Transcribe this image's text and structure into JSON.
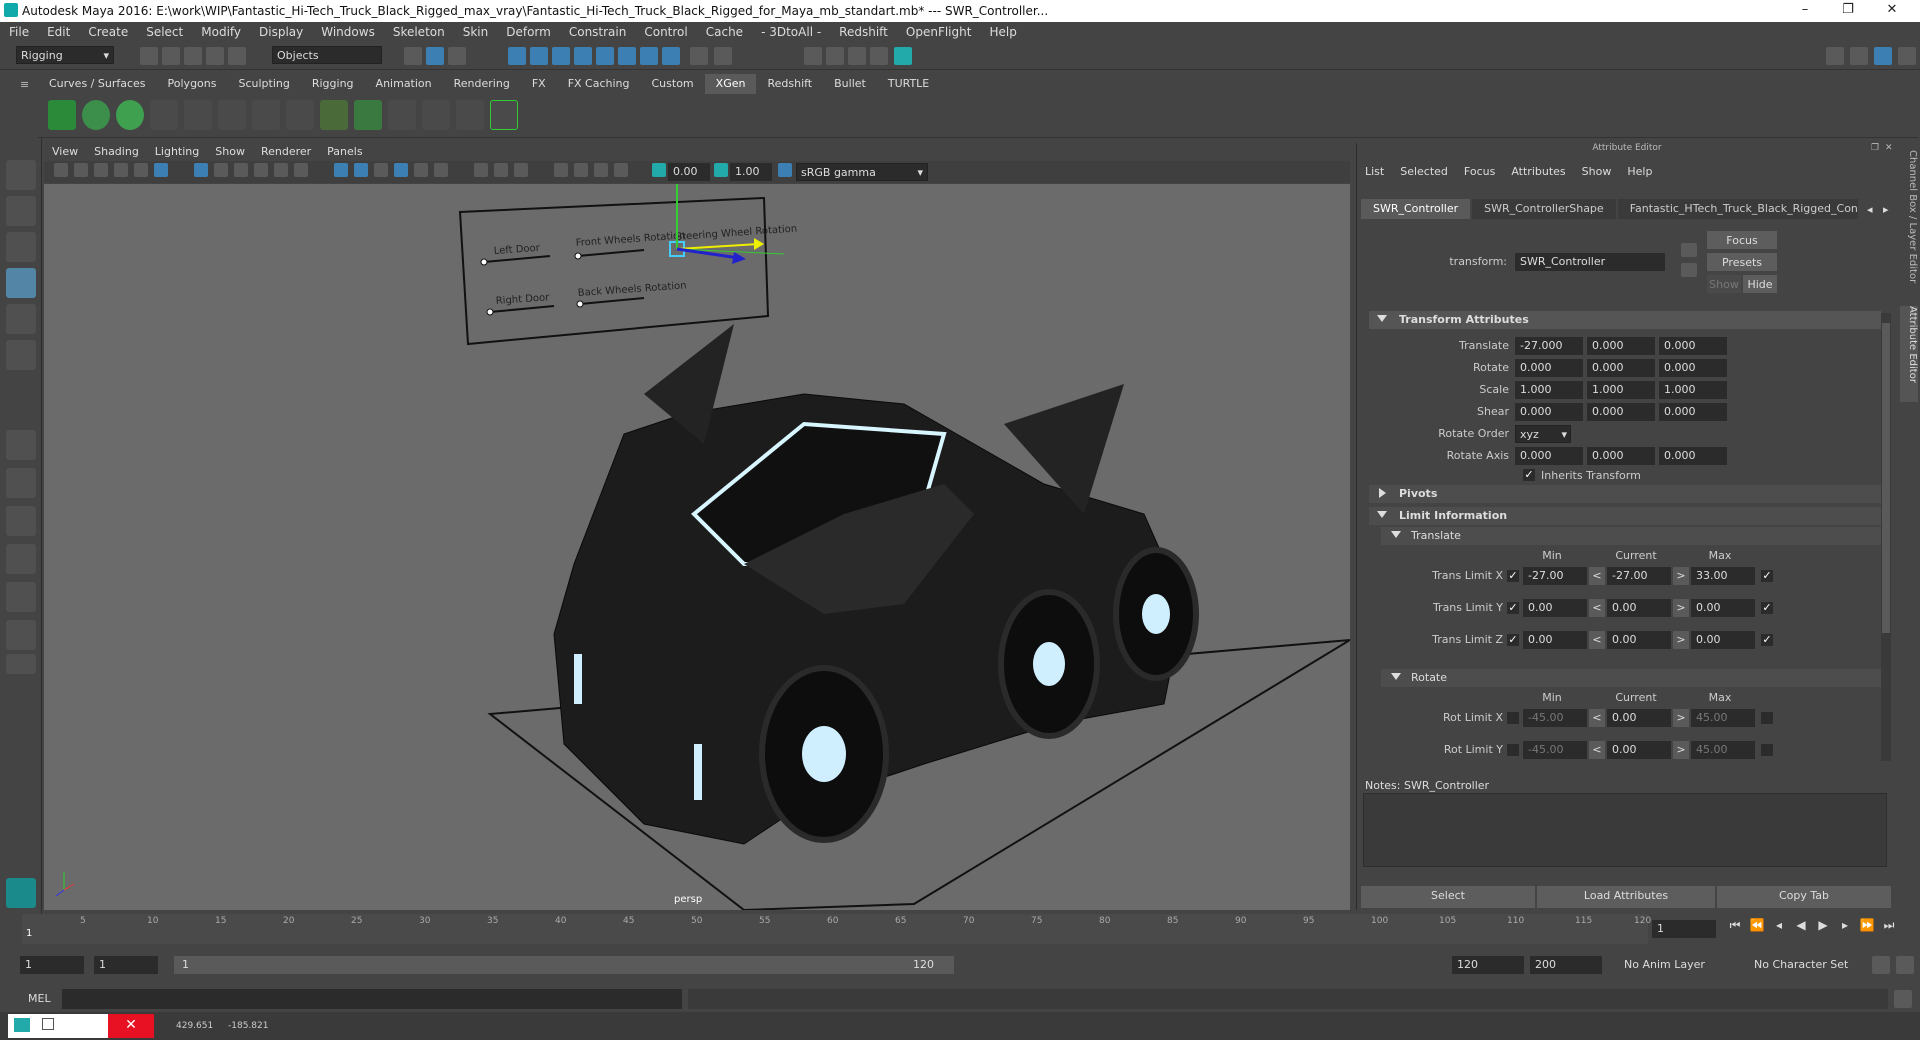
{
  "window": {
    "title": "Autodesk Maya 2016: E:\\work\\WIP\\Fantastic_Hi-Tech_Truck_Black_Rigged_max_vray\\Fantastic_Hi-Tech_Truck_Black_Rigged_for_Maya_mb_standart.mb*   ---   SWR_Controller...",
    "minimize": "–",
    "maximize": "❐",
    "close": "✕"
  },
  "menubar": [
    "File",
    "Edit",
    "Create",
    "Select",
    "Modify",
    "Display",
    "Windows",
    "Skeleton",
    "Skin",
    "Deform",
    "Constrain",
    "Control",
    "Cache",
    "- 3DtoAll -",
    "Redshift",
    "OpenFlight",
    "Help"
  ],
  "statusline": {
    "mode": "Rigging",
    "selection_mode": "Objects"
  },
  "shelf_tabs": [
    "Curves / Surfaces",
    "Polygons",
    "Sculpting",
    "Rigging",
    "Animation",
    "Rendering",
    "FX",
    "FX Caching",
    "Custom",
    "XGen",
    "Redshift",
    "Bullet",
    "TURTLE"
  ],
  "shelf_active": "XGen",
  "panel_menu": [
    "View",
    "Shading",
    "Lighting",
    "Show",
    "Renderer",
    "Panels"
  ],
  "panel_toolbar": {
    "exposure": "0.00",
    "gamma": "1.00",
    "color_space": "sRGB gamma"
  },
  "viewport": {
    "camera_label": "persp",
    "controller_labels": [
      "Left Door",
      "Front Wheels Rotation",
      "Steering Wheel Rotation",
      "Right Door",
      "Back Wheels Rotation"
    ]
  },
  "attribute_editor": {
    "header": "Attribute Editor",
    "menu": [
      "List",
      "Selected",
      "Focus",
      "Attributes",
      "Show",
      "Help"
    ],
    "tabs": [
      "SWR_Controller",
      "SWR_ControllerShape",
      "Fantastic_HTech_Truck_Black_Rigged_Controller"
    ],
    "transform_label": "transform:",
    "transform_value": "SWR_Controller",
    "buttons": {
      "focus": "Focus",
      "presets": "Presets",
      "show": "Show",
      "hide": "Hide"
    },
    "transform_attributes": {
      "title": "Transform Attributes",
      "translate": {
        "label": "Translate",
        "values": [
          "-27.000",
          "0.000",
          "0.000"
        ]
      },
      "rotate": {
        "label": "Rotate",
        "values": [
          "0.000",
          "0.000",
          "0.000"
        ]
      },
      "scale": {
        "label": "Scale",
        "values": [
          "1.000",
          "1.000",
          "1.000"
        ]
      },
      "shear": {
        "label": "Shear",
        "values": [
          "0.000",
          "0.000",
          "0.000"
        ]
      },
      "rotate_order": {
        "label": "Rotate Order",
        "value": "xyz"
      },
      "rotate_axis": {
        "label": "Rotate Axis",
        "values": [
          "0.000",
          "0.000",
          "0.000"
        ]
      },
      "inherits_transform": "Inherits Transform"
    },
    "pivots": "Pivots",
    "limit_information": "Limit Information",
    "translate_sub": "Translate",
    "rotate_sub": "Rotate",
    "col_headers": {
      "min": "Min",
      "current": "Current",
      "max": "Max"
    },
    "translate_limits": [
      {
        "label": "Trans Limit X",
        "min": "-27.00",
        "current": "-27.00",
        "max": "33.00"
      },
      {
        "label": "Trans Limit Y",
        "min": "0.00",
        "current": "0.00",
        "max": "0.00"
      },
      {
        "label": "Trans Limit Z",
        "min": "0.00",
        "current": "0.00",
        "max": "0.00"
      }
    ],
    "rotate_limits": [
      {
        "label": "Rot Limit X",
        "min": "-45.00",
        "current": "0.00",
        "max": "45.00"
      },
      {
        "label": "Rot Limit Y",
        "min": "-45.00",
        "current": "0.00",
        "max": "45.00"
      }
    ],
    "notes_label": "Notes:  SWR_Controller",
    "bottom_buttons": [
      "Select",
      "Load Attributes",
      "Copy Tab"
    ]
  },
  "side_tabs": {
    "channel_box": "Channel Box / Layer Editor",
    "attribute_editor": "Attribute Editor"
  },
  "timeline": {
    "ticks": [
      "1",
      "5",
      "10",
      "15",
      "20",
      "25",
      "30",
      "35",
      "40",
      "45",
      "50",
      "55",
      "60",
      "65",
      "70",
      "75",
      "80",
      "85",
      "90",
      "95",
      "100",
      "105",
      "110",
      "115",
      "120"
    ],
    "current_frame": "1"
  },
  "range": {
    "start": "1",
    "inner_start": "1",
    "slider_start": "1",
    "slider_end": "120",
    "end": "120",
    "outer_end": "200",
    "anim_layer": "No Anim Layer",
    "character_set": "No Character Set"
  },
  "command_line": {
    "label": "MEL"
  },
  "help_line": {
    "coord_x": "429.651",
    "coord_y": "-185.821"
  }
}
